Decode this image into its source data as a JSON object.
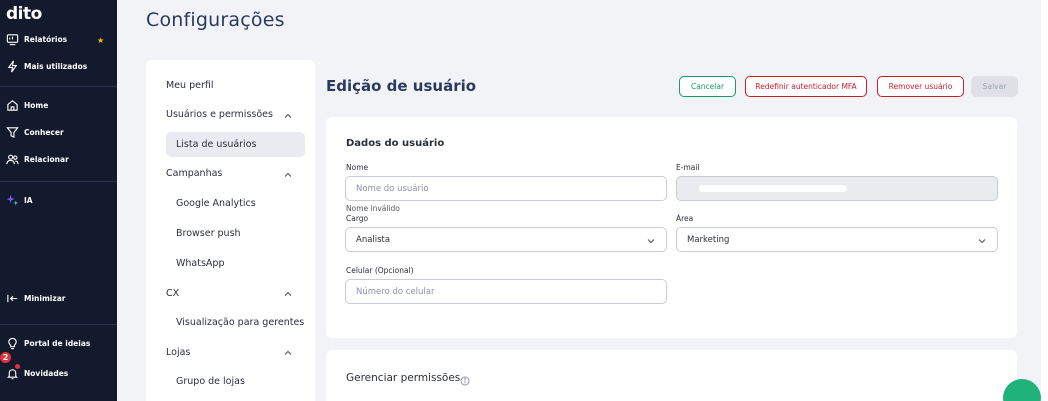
{
  "nav": {
    "logo": "dito",
    "items": [
      {
        "label": "Relatórios",
        "icon": "reports-icon"
      },
      {
        "label": "Mais utilizados",
        "icon": "lightning-icon"
      },
      {
        "label": "Home",
        "icon": "home-icon"
      },
      {
        "label": "Conhecer",
        "icon": "filter-icon"
      },
      {
        "label": "Relacionar",
        "icon": "users-icon"
      },
      {
        "label": "IA",
        "icon": "sparkles-icon"
      },
      {
        "label": "Minimizar",
        "icon": "collapse-icon"
      },
      {
        "label": "Portal de ideias",
        "icon": "lightbulb-icon"
      },
      {
        "label": "Novidades",
        "icon": "bell-icon"
      }
    ],
    "notification_count": "2",
    "accent_star": "#f2c200"
  },
  "page": {
    "title": "Configurações"
  },
  "menu": {
    "items": [
      {
        "label": "Meu perfil"
      },
      {
        "label": "Usuários e permissões"
      },
      {
        "label": "Lista de usuários"
      },
      {
        "label": "Campanhas"
      },
      {
        "label": "Google Analytics"
      },
      {
        "label": "Browser push"
      },
      {
        "label": "WhatsApp"
      },
      {
        "label": "CX"
      },
      {
        "label": "Visualização para gerentes"
      },
      {
        "label": "Lojas"
      },
      {
        "label": "Grupo de lojas"
      }
    ],
    "active_item": "Lista de usuários"
  },
  "main": {
    "title": "Edição de usuário",
    "buttons": {
      "cancel": "Cancelar",
      "reset_mfa": "Redefinir autenticador MFA",
      "remove": "Remover usuário",
      "save": "Salvar"
    }
  },
  "form": {
    "section_title": "Dados do usuário",
    "name": {
      "label": "Nome",
      "placeholder": "Nome do usuário",
      "error": "Nome inválido"
    },
    "email": {
      "label": "E-mail"
    },
    "role": {
      "label": "Cargo",
      "value": "Analista"
    },
    "area": {
      "label": "Área",
      "value": "Marketing"
    },
    "phone": {
      "label": "Celular (Opcional)",
      "placeholder": "Número do celular"
    }
  },
  "permissions": {
    "title": "Gerenciar permissões"
  },
  "colors": {
    "nav_bg": "#141a2e",
    "success": "#1a9a6c",
    "danger": "#c81e2d",
    "fab": "#1fb27a"
  }
}
